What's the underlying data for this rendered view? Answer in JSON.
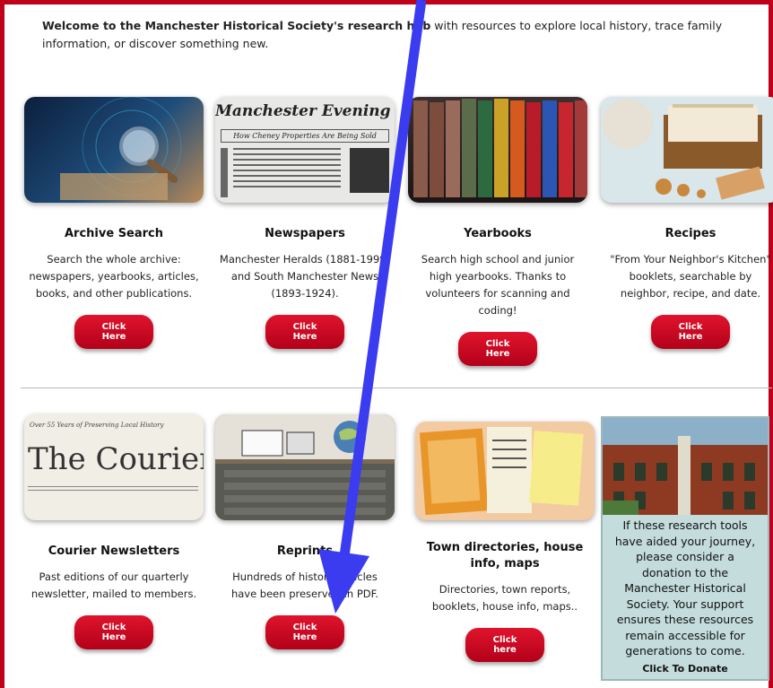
{
  "intro": {
    "bold": "Welcome to the Manchester Historical Society's research hub",
    "rest": " with resources to explore local history, trace family information, or discover something new."
  },
  "cards": [
    {
      "title": "Archive Search",
      "desc": "Search the whole archive: newspapers, yearbooks, articles, books, and other publications.",
      "button": "Click Here"
    },
    {
      "title": "Newspapers",
      "desc": "Manchester Heralds (1881-1999) and South Manchester News (1893-1924).",
      "button": "Click Here",
      "image_text": "Manchester Evening H",
      "image_subtext": "How Cheney Properties Are Being Sold"
    },
    {
      "title": "Yearbooks",
      "desc": "Search high school and junior high yearbooks. Thanks to volunteers for scanning and coding!",
      "button": "Click Here"
    },
    {
      "title": "Recipes",
      "desc": "\"From Your Neighbor's Kitchen\" booklets, searchable by neighbor, recipe, and date.",
      "button": "Click Here"
    },
    {
      "title": "Courier Newsletters",
      "desc": "Past editions of our quarterly newsletter, mailed to members.",
      "button": "Click Here",
      "image_text": "The Courier",
      "image_subtext": "Over 55 Years of Preserving Local History"
    },
    {
      "title": "Reprints",
      "desc": "Hundreds of historic articles have been preserved in PDF.",
      "button": "Click Here"
    },
    {
      "title": "Town directories, house info, maps",
      "desc": "Directories, town reports, booklets, house info, maps..",
      "button": "Click here"
    }
  ],
  "donate": {
    "text": "If these research tools have aided your journey, please consider a donation to the Manchester Historical Society. Your support ensures these resources remain accessible for generations to come.",
    "cta": "Click To Donate"
  },
  "colors": {
    "border": "#c0001a",
    "button": "#d0102a",
    "arrow": "#3b3bf0",
    "donate_bg": "#c4dcdc"
  },
  "annotation": {
    "type": "arrow"
  }
}
